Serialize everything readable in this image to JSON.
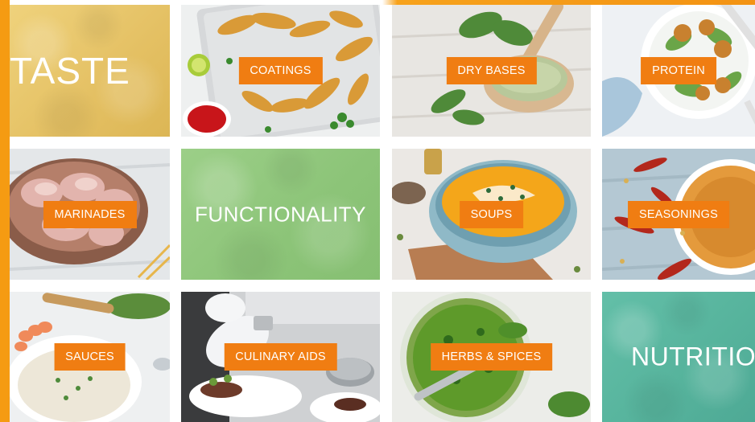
{
  "categories": {
    "taste": "TASTE",
    "coatings": "COATINGS",
    "dry_bases": "DRY BASES",
    "protein": "PROTEIN",
    "marinades": "MARINADES",
    "functionality": "FUNCTIONALITY",
    "soups": "SOUPS",
    "seasonings": "SEASONINGS",
    "sauces": "SAUCES",
    "culinary_aids": "CULINARY AIDS",
    "herbs_spices": "HERBS & SPICES",
    "nutrition": "NUTRITIO"
  },
  "colors": {
    "accent": "#f59b12",
    "badge": "#f07d12",
    "taste_bg": "#e8c46a",
    "functionality_bg": "#92c77f",
    "nutrition_bg": "#5bb8a1"
  }
}
